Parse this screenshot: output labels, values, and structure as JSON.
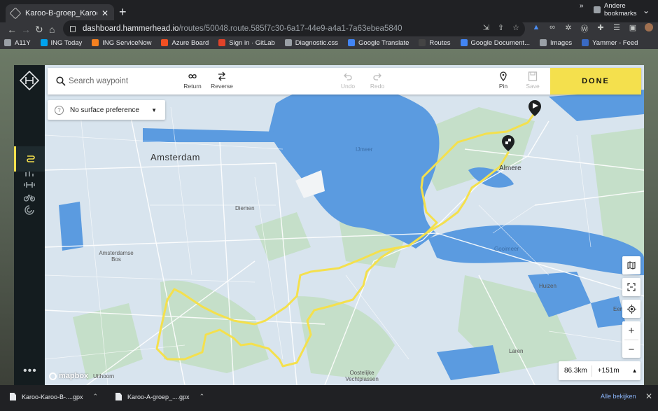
{
  "browser": {
    "tab_title": "Karoo-B-groep_Karoo-Ronde...",
    "tab_close": "✕",
    "new_tab": "+",
    "url_host": "dashboard.hammerhead.io",
    "url_path": "/routes/50048.route.585f7c30-6a17-44e9-a4a1-7a63ebea5840",
    "bookmarks": [
      {
        "label": "A11Y",
        "icon": "folder-icon",
        "color": "#9aa0a6"
      },
      {
        "label": "ING Today",
        "icon": "windows-icon",
        "color": "#00a4ef"
      },
      {
        "label": "ING ServiceNow",
        "icon": "servicenow-icon",
        "color": "#f48120"
      },
      {
        "label": "Azure Board",
        "icon": "windows-icon",
        "color": "#f25022"
      },
      {
        "label": "Sign in · GitLab",
        "icon": "gitlab-icon",
        "color": "#e24329"
      },
      {
        "label": "Diagnostic.css",
        "icon": "globe-icon",
        "color": "#9aa0a6"
      },
      {
        "label": "Google Translate",
        "icon": "translate-icon",
        "color": "#4285f4"
      },
      {
        "label": "Routes",
        "icon": "hammerhead-icon",
        "color": "#444444"
      },
      {
        "label": "Google Document...",
        "icon": "docs-icon",
        "color": "#4285f4"
      },
      {
        "label": "Images",
        "icon": "globe-icon",
        "color": "#9aa0a6"
      },
      {
        "label": "Yammer - Feed",
        "icon": "yammer-icon",
        "color": "#396ac4"
      }
    ],
    "bookmarks_more": "»",
    "other_bookmarks": "Andere bookmarks"
  },
  "app": {
    "search": {
      "placeholder": "Search waypoint"
    },
    "tools": {
      "return": "Return",
      "reverse": "Reverse",
      "undo": "Undo",
      "redo": "Redo",
      "pin": "Pin",
      "save": "Save"
    },
    "done_label": "DONE",
    "surface_preference": "No surface preference",
    "stats": {
      "distance": "86.3km",
      "elevation": "+151m"
    },
    "attribution": "mapbox",
    "sidebar_more": "•••"
  },
  "map": {
    "labels": {
      "amsterdam": "Amsterdam",
      "almere": "Almere",
      "ijmeer": "IJmeer",
      "diemen": "Diemen",
      "gooimeer": "Gooimeer",
      "huizen": "Huizen",
      "laren": "Laren",
      "amsterdamse_bos": "Amsterdamse Bos",
      "uithoorn": "Uithoorn",
      "oostelijke_vechtplassen": "Oostelijke Vechtplassen",
      "eem": "Eem"
    },
    "colors": {
      "water": "#5b9be0",
      "land": "#d8e4ee",
      "green": "#c3dec9",
      "route": "#f4e04d",
      "accent": "#f4e04d"
    }
  },
  "downloads": {
    "items": [
      "Karoo-Karoo-B-....gpx",
      "Karoo-A-groep_....gpx"
    ],
    "show_all": "Alle bekijken",
    "close": "✕"
  }
}
